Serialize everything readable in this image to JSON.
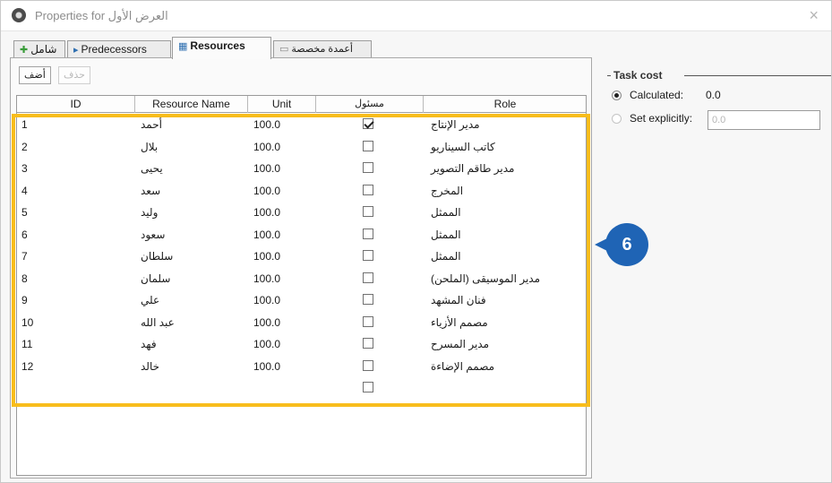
{
  "window": {
    "title": "Properties for العرض الأول",
    "close": "×"
  },
  "tabs": [
    {
      "label": "شامل",
      "icon": "✚"
    },
    {
      "label": "Predecessors",
      "icon": "▸"
    },
    {
      "label": "Resources",
      "icon": "▦"
    },
    {
      "label": "أعمدة مخصصة",
      "icon": "▭"
    }
  ],
  "toolbar": {
    "add_label": "أضف",
    "delete_label": "حذف"
  },
  "table": {
    "headers": [
      "ID",
      "Resource Name",
      "Unit",
      "مسئول",
      "Role"
    ],
    "rows": [
      {
        "id": "1",
        "name": "أحمد",
        "unit": "100.0",
        "checked": true,
        "role": "مدير الإنتاج"
      },
      {
        "id": "2",
        "name": "بلال",
        "unit": "100.0",
        "checked": false,
        "role": "كاتب السيناريو"
      },
      {
        "id": "3",
        "name": "يحيى",
        "unit": "100.0",
        "checked": false,
        "role": "مدير طاقم التصوير"
      },
      {
        "id": "4",
        "name": "سعد",
        "unit": "100.0",
        "checked": false,
        "role": "المخرج"
      },
      {
        "id": "5",
        "name": "وليد",
        "unit": "100.0",
        "checked": false,
        "role": "الممثل"
      },
      {
        "id": "6",
        "name": "سعود",
        "unit": "100.0",
        "checked": false,
        "role": "الممثل"
      },
      {
        "id": "7",
        "name": "سلطان",
        "unit": "100.0",
        "checked": false,
        "role": "الممثل"
      },
      {
        "id": "8",
        "name": "سلمان",
        "unit": "100.0",
        "checked": false,
        "role": "مدير الموسيقى (الملحن)"
      },
      {
        "id": "9",
        "name": "علي",
        "unit": "100.0",
        "checked": false,
        "role": "فنان المشهد"
      },
      {
        "id": "10",
        "name": "عبد الله",
        "unit": "100.0",
        "checked": false,
        "role": "مصمم الأزياء"
      },
      {
        "id": "11",
        "name": "فهد",
        "unit": "100.0",
        "checked": false,
        "role": "مدير المسرح"
      },
      {
        "id": "12",
        "name": "خالد",
        "unit": "100.0",
        "checked": false,
        "role": "مصمم الإضاءة"
      },
      {
        "id": "",
        "name": "",
        "unit": "",
        "checked": false,
        "role": ""
      }
    ]
  },
  "callout": {
    "number": "6"
  },
  "task_cost": {
    "title": "Task cost",
    "calculated_label": "Calculated:",
    "calculated_value": "0.0",
    "explicit_label": "Set explicitly:",
    "explicit_value": "0.0"
  },
  "colors": {
    "highlight": "#f8bd1c",
    "callout": "#1f64b5"
  }
}
